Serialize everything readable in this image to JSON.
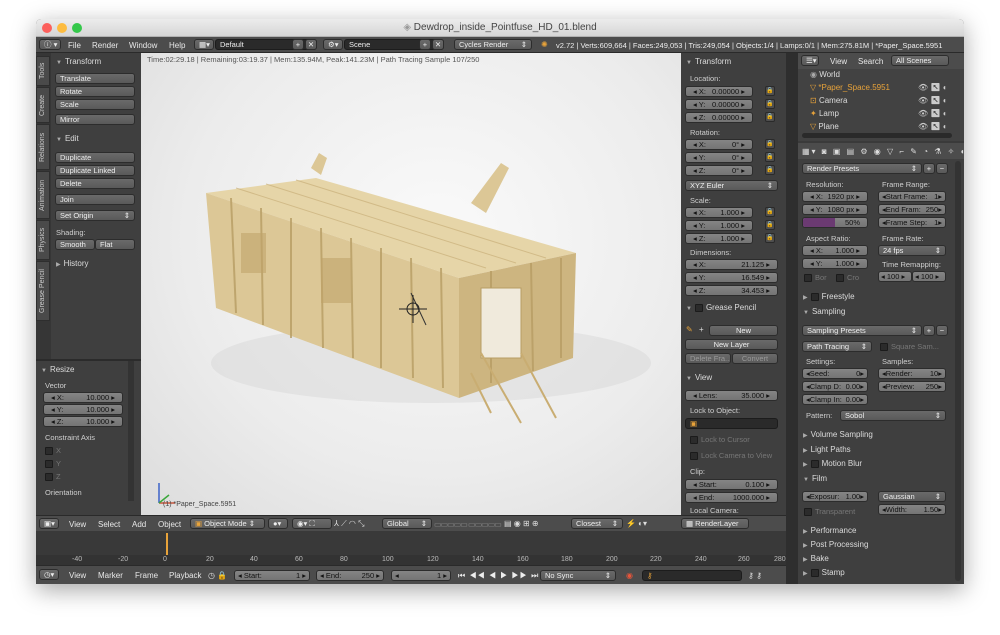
{
  "window": {
    "title": "Dewdrop_inside_Pointfuse_HD_01.blend",
    "colors": {
      "close": "#fc605c",
      "minimize": "#fdbc40",
      "maximize": "#34c84a",
      "accent_orange": "#e8a33a",
      "progress_purple": "#6b3a72"
    }
  },
  "topbar": {
    "menus": [
      "File",
      "Render",
      "Window",
      "Help"
    ],
    "layout": "Default",
    "scene": "Scene",
    "engine": "Cycles Render",
    "stats": "v2.72 | Verts:609,664 | Faces:249,053 | Tris:249,054 | Objects:1/4 | Lamps:0/1 | Mem:275.81M | *Paper_Space.5951"
  },
  "left": {
    "tabs": [
      "Tools",
      "Create",
      "Relations",
      "Animation",
      "Physics",
      "Grease Pencil"
    ],
    "transform_title": "Transform",
    "translate": "Translate",
    "rotate": "Rotate",
    "scale": "Scale",
    "mirror": "Mirror",
    "edit_title": "Edit",
    "duplicate": "Duplicate",
    "duplicate_linked": "Duplicate Linked",
    "delete": "Delete",
    "join": "Join",
    "set_origin": "Set Origin",
    "shading": "Shading:",
    "smooth": "Smooth",
    "flat": "Flat",
    "history": "History",
    "resize_title": "Resize",
    "vector": "Vector",
    "vx": {
      "label": "X:",
      "value": "10.000"
    },
    "vy": {
      "label": "Y:",
      "value": "10.000"
    },
    "vz": {
      "label": "Z:",
      "value": "10.000"
    },
    "constraint_axis": "Constraint Axis",
    "cx": "X",
    "cy": "Y",
    "cz": "Z",
    "orientation": "Orientation"
  },
  "viewport": {
    "info": "Time:02:29.18 | Remaining:03:19.37 | Mem:135.94M, Peak:141.23M | Path Tracing Sample 107/250",
    "object_label": "(1) *Paper_Space.5951"
  },
  "npanel": {
    "title": "Transform",
    "location": "Location:",
    "loc": [
      {
        "l": "X:",
        "v": "0.00000"
      },
      {
        "l": "Y:",
        "v": "0.00000"
      },
      {
        "l": "Z:",
        "v": "0.00000"
      }
    ],
    "rotation": "Rotation:",
    "rot": [
      {
        "l": "X:",
        "v": "0°"
      },
      {
        "l": "Y:",
        "v": "0°"
      },
      {
        "l": "Z:",
        "v": "0°"
      }
    ],
    "euler": "XYZ Euler",
    "scale": "Scale:",
    "scl": [
      {
        "l": "X:",
        "v": "1.000"
      },
      {
        "l": "Y:",
        "v": "1.000"
      },
      {
        "l": "Z:",
        "v": "1.000"
      }
    ],
    "dimensions": "Dimensions:",
    "dim": [
      {
        "l": "X:",
        "v": "21.125"
      },
      {
        "l": "Y:",
        "v": "16.549"
      },
      {
        "l": "Z:",
        "v": "34.453"
      }
    ],
    "grease_pencil": "Grease Pencil",
    "new": "New",
    "new_layer": "New Layer",
    "delete_frame": "Delete Fra...",
    "convert": "Convert",
    "view_title": "View",
    "lens": {
      "l": "Lens:",
      "v": "35.000"
    },
    "lock_to_object": "Lock to Object:",
    "lock_to_cursor": "Lock to Cursor",
    "lock_camera": "Lock Camera to View",
    "clip": "Clip:",
    "clip_start": {
      "l": "Start:",
      "v": "0.100"
    },
    "clip_end": {
      "l": "End:",
      "v": "1000.000"
    },
    "local_camera": "Local Camera:"
  },
  "outliner": {
    "view": "View",
    "search": "Search",
    "all_scenes": "All Scenes",
    "items": [
      "World",
      "*Paper_Space.5951",
      "Camera",
      "Lamp",
      "Plane"
    ]
  },
  "props": {
    "render_presets": "Render Presets",
    "resolution": "Resolution:",
    "res_x": {
      "l": "X:",
      "v": "1920 px"
    },
    "res_y": {
      "l": "Y:",
      "v": "1080 px"
    },
    "res_pct": "50%",
    "res_pct_value": 0.5,
    "frame_range": "Frame Range:",
    "start_frame": {
      "l": "Start Frame:",
      "v": "1"
    },
    "end_frame": {
      "l": "End Fram:",
      "v": "250"
    },
    "frame_step": {
      "l": "Frame Step:",
      "v": "1"
    },
    "aspect_ratio": "Aspect Ratio:",
    "asp_x": {
      "l": "X:",
      "v": "1.000"
    },
    "asp_y": {
      "l": "Y:",
      "v": "1.000"
    },
    "bor": "Bor",
    "cro": "Cro",
    "frame_rate": "Frame Rate:",
    "fps": "24 fps",
    "time_remapping": "Time Remapping:",
    "remap_old": "100",
    "remap_new": "100",
    "freestyle": "Freestyle",
    "sampling": "Sampling",
    "sampling_presets": "Sampling Presets",
    "path_tracing": "Path Tracing",
    "square_samples": "Square Sam...",
    "settings": "Settings:",
    "seed": {
      "l": "Seed:",
      "v": "0"
    },
    "clamp_direct": {
      "l": "Clamp D:",
      "v": "0.00"
    },
    "clamp_indirect": {
      "l": "Clamp In:",
      "v": "0.00"
    },
    "samples": "Samples:",
    "render_samples": {
      "l": "Render:",
      "v": "10"
    },
    "preview_samples": {
      "l": "Preview:",
      "v": "250"
    },
    "pattern": "Pattern:",
    "pattern_value": "Sobol",
    "volume_sampling": "Volume Sampling",
    "light_paths": "Light Paths",
    "motion_blur": "Motion Blur",
    "film": "Film",
    "exposure": {
      "l": "Exposur:",
      "v": "1.00"
    },
    "filter": "Gaussian",
    "width": {
      "l": "Width:",
      "v": "1.50"
    },
    "transparent": "Transparent",
    "performance": "Performance",
    "post_processing": "Post Processing",
    "bake": "Bake",
    "stamp": "Stamp"
  },
  "viewheader": {
    "view": "View",
    "select": "Select",
    "add": "Add",
    "object": "Object",
    "mode": "Object Mode",
    "orientation": "Global",
    "snap": "Closest",
    "render_layer": "RenderLayer"
  },
  "timeline": {
    "ticks": [
      "-40",
      "-20",
      "0",
      "20",
      "40",
      "60",
      "80",
      "100",
      "120",
      "140",
      "160",
      "180",
      "200",
      "220",
      "240",
      "260",
      "280"
    ],
    "current_frame": 1
  },
  "bottom": {
    "view": "View",
    "marker": "Marker",
    "frame": "Frame",
    "playback": "Playback",
    "start": {
      "l": "Start:",
      "v": "1"
    },
    "end": {
      "l": "End:",
      "v": "250"
    },
    "current": "1",
    "sync": "No Sync"
  }
}
